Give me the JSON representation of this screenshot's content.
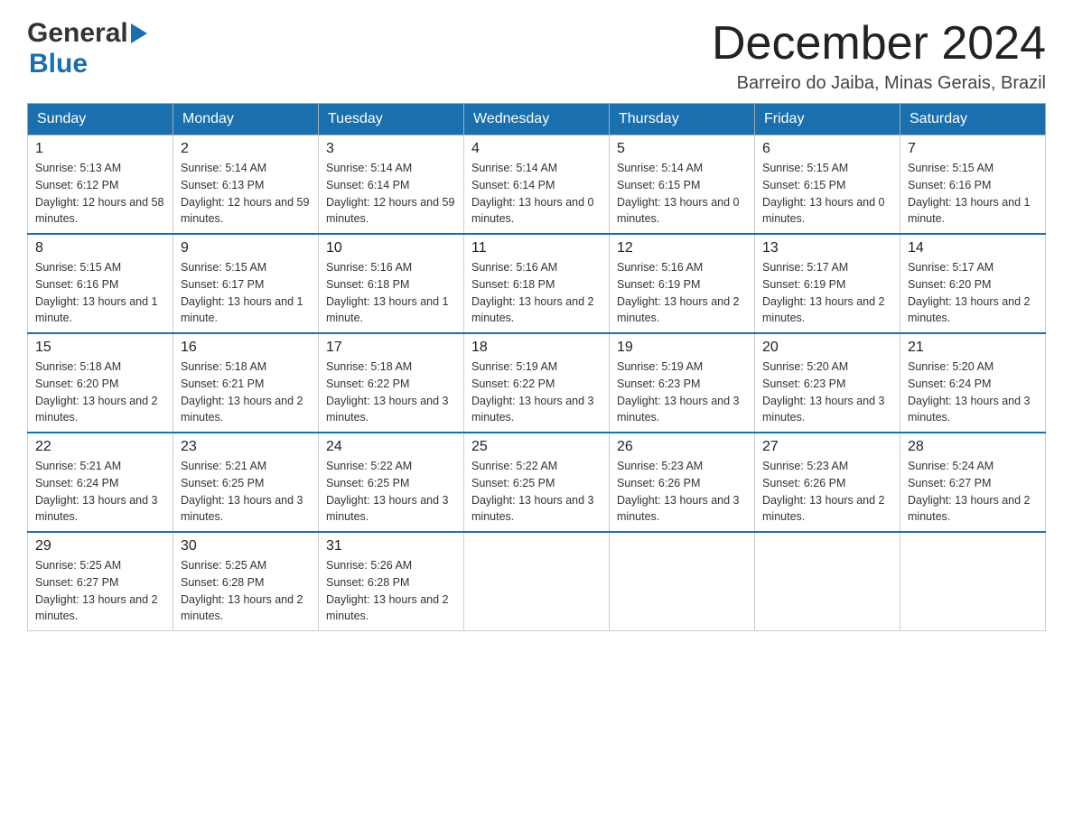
{
  "header": {
    "logo_general": "General",
    "logo_blue": "Blue",
    "title": "December 2024",
    "subtitle": "Barreiro do Jaiba, Minas Gerais, Brazil"
  },
  "calendar": {
    "days_of_week": [
      "Sunday",
      "Monday",
      "Tuesday",
      "Wednesday",
      "Thursday",
      "Friday",
      "Saturday"
    ],
    "weeks": [
      [
        {
          "day": "1",
          "sunrise": "5:13 AM",
          "sunset": "6:12 PM",
          "daylight": "12 hours and 58 minutes."
        },
        {
          "day": "2",
          "sunrise": "5:14 AM",
          "sunset": "6:13 PM",
          "daylight": "12 hours and 59 minutes."
        },
        {
          "day": "3",
          "sunrise": "5:14 AM",
          "sunset": "6:14 PM",
          "daylight": "12 hours and 59 minutes."
        },
        {
          "day": "4",
          "sunrise": "5:14 AM",
          "sunset": "6:14 PM",
          "daylight": "13 hours and 0 minutes."
        },
        {
          "day": "5",
          "sunrise": "5:14 AM",
          "sunset": "6:15 PM",
          "daylight": "13 hours and 0 minutes."
        },
        {
          "day": "6",
          "sunrise": "5:15 AM",
          "sunset": "6:15 PM",
          "daylight": "13 hours and 0 minutes."
        },
        {
          "day": "7",
          "sunrise": "5:15 AM",
          "sunset": "6:16 PM",
          "daylight": "13 hours and 1 minute."
        }
      ],
      [
        {
          "day": "8",
          "sunrise": "5:15 AM",
          "sunset": "6:16 PM",
          "daylight": "13 hours and 1 minute."
        },
        {
          "day": "9",
          "sunrise": "5:15 AM",
          "sunset": "6:17 PM",
          "daylight": "13 hours and 1 minute."
        },
        {
          "day": "10",
          "sunrise": "5:16 AM",
          "sunset": "6:18 PM",
          "daylight": "13 hours and 1 minute."
        },
        {
          "day": "11",
          "sunrise": "5:16 AM",
          "sunset": "6:18 PM",
          "daylight": "13 hours and 2 minutes."
        },
        {
          "day": "12",
          "sunrise": "5:16 AM",
          "sunset": "6:19 PM",
          "daylight": "13 hours and 2 minutes."
        },
        {
          "day": "13",
          "sunrise": "5:17 AM",
          "sunset": "6:19 PM",
          "daylight": "13 hours and 2 minutes."
        },
        {
          "day": "14",
          "sunrise": "5:17 AM",
          "sunset": "6:20 PM",
          "daylight": "13 hours and 2 minutes."
        }
      ],
      [
        {
          "day": "15",
          "sunrise": "5:18 AM",
          "sunset": "6:20 PM",
          "daylight": "13 hours and 2 minutes."
        },
        {
          "day": "16",
          "sunrise": "5:18 AM",
          "sunset": "6:21 PM",
          "daylight": "13 hours and 2 minutes."
        },
        {
          "day": "17",
          "sunrise": "5:18 AM",
          "sunset": "6:22 PM",
          "daylight": "13 hours and 3 minutes."
        },
        {
          "day": "18",
          "sunrise": "5:19 AM",
          "sunset": "6:22 PM",
          "daylight": "13 hours and 3 minutes."
        },
        {
          "day": "19",
          "sunrise": "5:19 AM",
          "sunset": "6:23 PM",
          "daylight": "13 hours and 3 minutes."
        },
        {
          "day": "20",
          "sunrise": "5:20 AM",
          "sunset": "6:23 PM",
          "daylight": "13 hours and 3 minutes."
        },
        {
          "day": "21",
          "sunrise": "5:20 AM",
          "sunset": "6:24 PM",
          "daylight": "13 hours and 3 minutes."
        }
      ],
      [
        {
          "day": "22",
          "sunrise": "5:21 AM",
          "sunset": "6:24 PM",
          "daylight": "13 hours and 3 minutes."
        },
        {
          "day": "23",
          "sunrise": "5:21 AM",
          "sunset": "6:25 PM",
          "daylight": "13 hours and 3 minutes."
        },
        {
          "day": "24",
          "sunrise": "5:22 AM",
          "sunset": "6:25 PM",
          "daylight": "13 hours and 3 minutes."
        },
        {
          "day": "25",
          "sunrise": "5:22 AM",
          "sunset": "6:25 PM",
          "daylight": "13 hours and 3 minutes."
        },
        {
          "day": "26",
          "sunrise": "5:23 AM",
          "sunset": "6:26 PM",
          "daylight": "13 hours and 3 minutes."
        },
        {
          "day": "27",
          "sunrise": "5:23 AM",
          "sunset": "6:26 PM",
          "daylight": "13 hours and 2 minutes."
        },
        {
          "day": "28",
          "sunrise": "5:24 AM",
          "sunset": "6:27 PM",
          "daylight": "13 hours and 2 minutes."
        }
      ],
      [
        {
          "day": "29",
          "sunrise": "5:25 AM",
          "sunset": "6:27 PM",
          "daylight": "13 hours and 2 minutes."
        },
        {
          "day": "30",
          "sunrise": "5:25 AM",
          "sunset": "6:28 PM",
          "daylight": "13 hours and 2 minutes."
        },
        {
          "day": "31",
          "sunrise": "5:26 AM",
          "sunset": "6:28 PM",
          "daylight": "13 hours and 2 minutes."
        },
        null,
        null,
        null,
        null
      ]
    ]
  }
}
